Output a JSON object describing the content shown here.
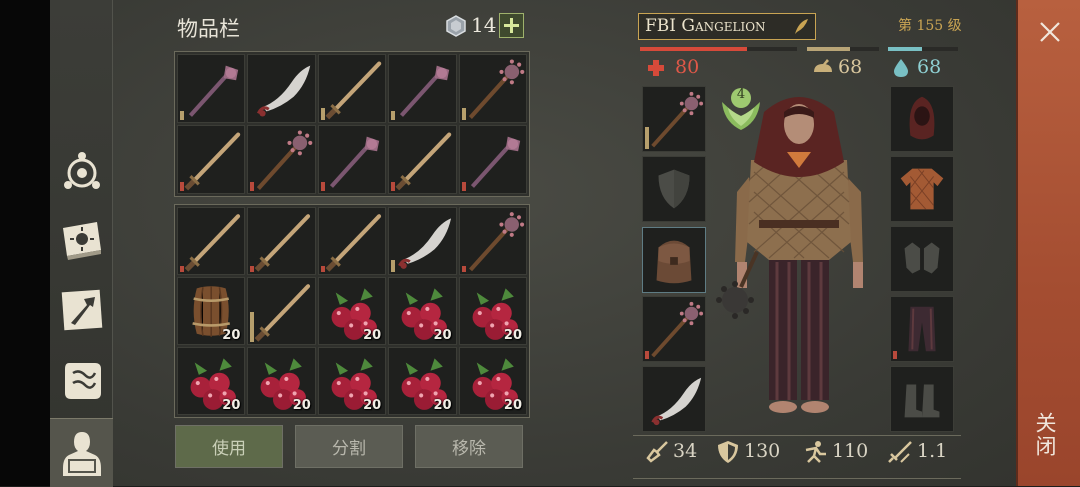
{
  "inventory": {
    "title": "物品栏",
    "currency_value": "14",
    "add_icon": "plus-icon",
    "currency_icon": "gem-icon",
    "rows_top": [
      [
        {
          "icon": "mace-icon",
          "dura": 0.15
        },
        {
          "icon": "scimitar-icon",
          "dura": null
        },
        {
          "icon": "sword-icon",
          "dura": 0.2
        },
        {
          "icon": "mace-icon",
          "dura": 0.15
        },
        {
          "icon": "spiked-mace-icon",
          "dura": 0.2
        }
      ],
      [
        {
          "icon": "sword-icon",
          "dura": 0.15,
          "low": true
        },
        {
          "icon": "spiked-mace-icon",
          "dura": 0.15,
          "low": true
        },
        {
          "icon": "mace-icon",
          "dura": 0.15,
          "low": true
        },
        {
          "icon": "sword-icon",
          "dura": 0.15,
          "low": true
        },
        {
          "icon": "mace-icon",
          "dura": 0.15,
          "low": true
        }
      ]
    ],
    "rows_bottom": [
      [
        {
          "icon": "sword-icon",
          "dura": 0.1,
          "low": true
        },
        {
          "icon": "sword-icon",
          "dura": 0.1,
          "low": true
        },
        {
          "icon": "sword-icon",
          "dura": 0.1,
          "low": true
        },
        {
          "icon": "scimitar-icon",
          "dura": 0.2
        },
        {
          "icon": "spiked-mace-icon",
          "dura": 0.1,
          "low": true
        }
      ],
      [
        {
          "icon": "barrel-icon",
          "qty": "20"
        },
        {
          "icon": "sword-icon",
          "dura": 0.5
        },
        {
          "icon": "berries-icon",
          "qty": "20"
        },
        {
          "icon": "berries-icon",
          "qty": "20"
        },
        {
          "icon": "berries-icon",
          "qty": "20"
        }
      ],
      [
        {
          "icon": "berries-icon",
          "qty": "20"
        },
        {
          "icon": "berries-icon",
          "qty": "20"
        },
        {
          "icon": "berries-icon",
          "qty": "20"
        },
        {
          "icon": "berries-icon",
          "qty": "20"
        },
        {
          "icon": "berries-icon",
          "qty": "20"
        }
      ]
    ],
    "buttons": {
      "use": "使用",
      "split": "分割",
      "remove": "移除"
    }
  },
  "character": {
    "name": "FBI Gangelion",
    "level": "第 155 级",
    "health": "80",
    "food": "68",
    "water": "68",
    "health_fraction": 0.68,
    "food_fraction": 0.6,
    "water_fraction": 0.48,
    "rank": "4",
    "stats": {
      "attack": "34",
      "defense": "130",
      "speed": "110",
      "weight": "1.1"
    },
    "left_slots": [
      "spiked-mace-icon",
      "shield-icon",
      "backpack-icon",
      "spiked-mace-icon",
      "scimitar-icon"
    ],
    "right_slots": [
      "hood-icon",
      "shirt-icon",
      "gloves-icon",
      "pants-icon",
      "boots-icon"
    ]
  },
  "close": {
    "label": "关闭",
    "icon": "close-icon"
  },
  "sidenav": [
    "compass-icon",
    "sun-book-icon",
    "crafting-icon",
    "scroll-icon",
    "character-icon"
  ],
  "colors": {
    "health": "#d64a3a",
    "food": "#b9a577",
    "water": "#79c0c4",
    "accent": "#c9a453"
  }
}
